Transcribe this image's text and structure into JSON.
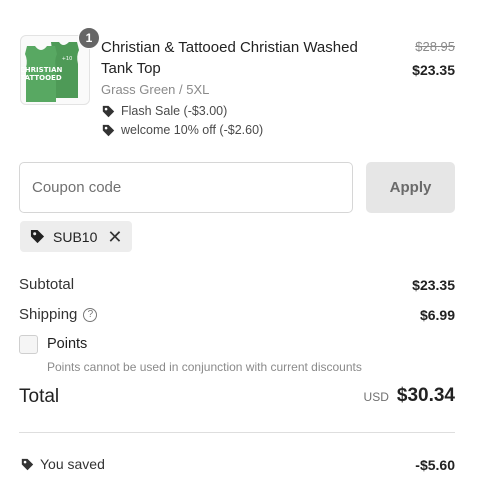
{
  "product": {
    "quantity": "1",
    "title": "Christian & Tattooed Christian Washed Tank Top",
    "variant": "Grass Green / 5XL",
    "discounts": [
      "Flash Sale (-$3.00)",
      "welcome 10% off (-$2.60)"
    ],
    "original_price": "$28.95",
    "price": "$23.35",
    "image_icon": "green-tank-top-thumbnail",
    "image_color": "#4e9a57"
  },
  "coupon": {
    "placeholder": "Coupon code",
    "apply_label": "Apply",
    "applied_code": "SUB10"
  },
  "summary": {
    "subtotal_label": "Subtotal",
    "subtotal_value": "$23.35",
    "shipping_label": "Shipping",
    "shipping_help": "?",
    "shipping_value": "$6.99",
    "points_label": "Points",
    "points_note": "Points cannot be used in conjunction with current discounts",
    "total_label": "Total",
    "currency": "USD",
    "total_value": "$30.34",
    "saved_label": "You saved",
    "saved_value": "-$5.60"
  }
}
